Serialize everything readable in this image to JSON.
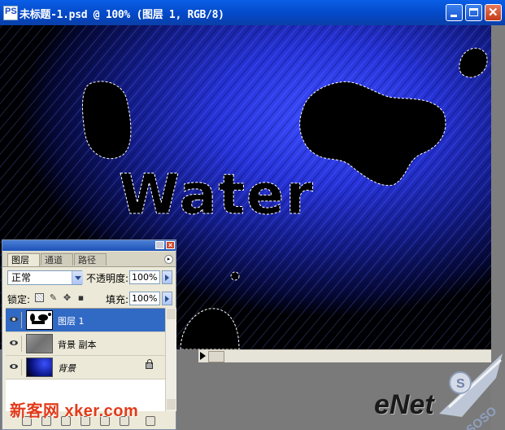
{
  "window": {
    "title": "未标题-1.psd @ 100% (图层 1, RGB/8)",
    "app_icon_label": "PS"
  },
  "canvas": {
    "artwork_text": "Water",
    "background_color": "#000000",
    "accent_color": "#2a3cff"
  },
  "layers_panel": {
    "tabs": [
      {
        "label": "图层",
        "active": true
      },
      {
        "label": "通道",
        "active": false
      },
      {
        "label": "路径",
        "active": false
      }
    ],
    "blend_mode": "正常",
    "opacity_label": "不透明度:",
    "opacity_value": "100%",
    "lock_label": "锁定:",
    "fill_label": "填充:",
    "fill_value": "100%",
    "layers": [
      {
        "name": "图层 1",
        "selected": true,
        "visible": true
      },
      {
        "name": "背景 副本",
        "selected": false,
        "visible": true
      },
      {
        "name": "背景",
        "selected": false,
        "visible": true,
        "locked": true
      }
    ]
  },
  "watermarks": {
    "left": "新客网 xker.com",
    "right_logo": "eNet",
    "badge_text": "SOSO"
  }
}
